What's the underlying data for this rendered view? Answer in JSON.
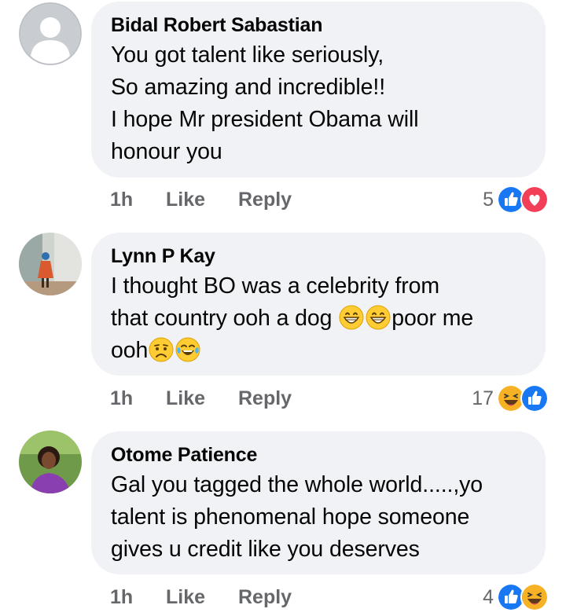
{
  "comments": [
    {
      "author": "Bidal Robert Sabastian",
      "lines": [
        "You got talent like seriously,",
        "So amazing and incredible!!",
        "I hope Mr president Obama will",
        "honour you"
      ],
      "time": "1h",
      "like_label": "Like",
      "reply_label": "Reply",
      "reaction_count": "5",
      "reactions": [
        "like-icon",
        "love-icon"
      ]
    },
    {
      "author": "Lynn P Kay",
      "lines": [
        "I thought BO was a celebrity from",
        "that country ooh a dog",
        "poor me",
        "ooh"
      ],
      "time": "1h",
      "like_label": "Like",
      "reply_label": "Reply",
      "reaction_count": "17",
      "reactions": [
        "haha-icon",
        "like-icon"
      ]
    },
    {
      "author": "Otome Patience",
      "lines": [
        "Gal you tagged the whole world.....,yo",
        "talent is phenomenal hope someone",
        "gives u credit like you deserves"
      ],
      "time": "1h",
      "like_label": "Like",
      "reply_label": "Reply",
      "reaction_count": "4",
      "reactions": [
        "like-icon",
        "haha-icon"
      ]
    }
  ],
  "colors": {
    "bubble": "#f0f2f5",
    "meta_text": "#65676b",
    "like_blue": "#1877f2",
    "love_red": "#f33e58",
    "haha_yellow": "#f7b125"
  }
}
